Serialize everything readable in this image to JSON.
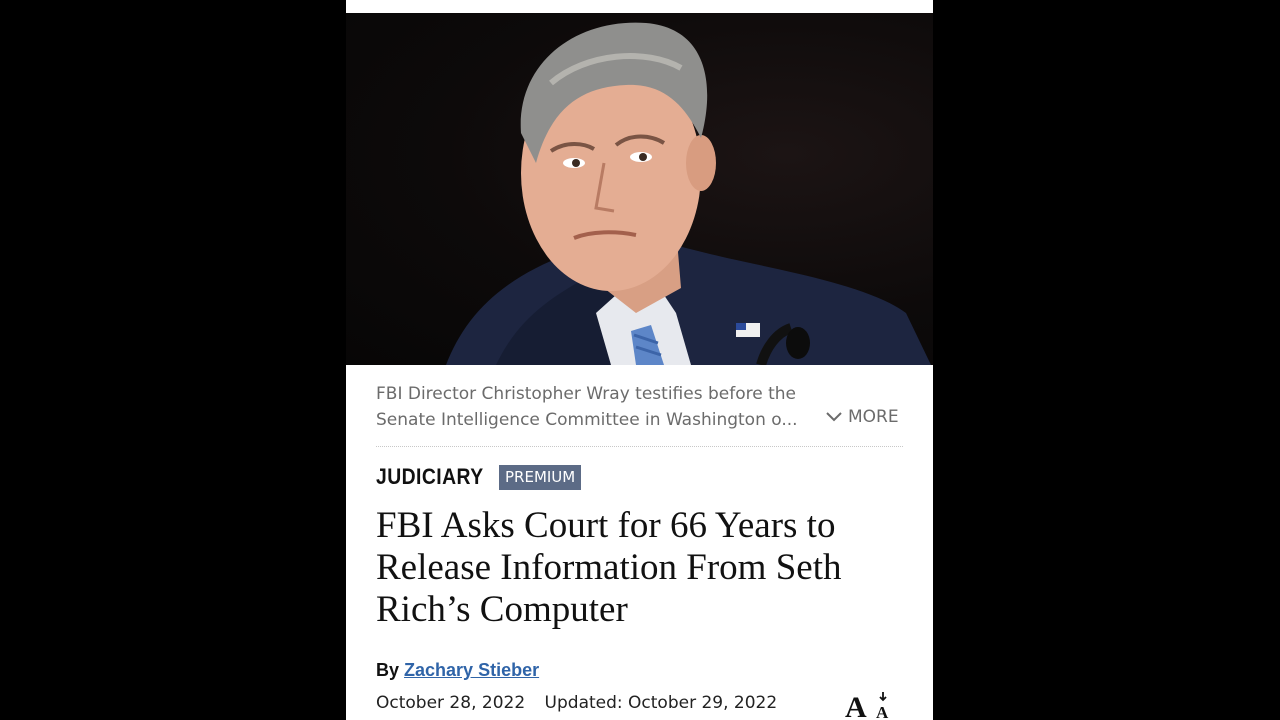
{
  "article": {
    "image_alt": "FBI Director Christopher Wray",
    "caption_lines": [
      "FBI Director Christopher Wray testifies before the",
      "Senate Intelligence Committee in Washington o..."
    ],
    "more_label": "MORE",
    "section": "JUDICIARY",
    "badge": "PREMIUM",
    "headline": "FBI Asks Court for 66 Years to Release Information From Seth Rich’s Computer",
    "byline_prefix": "By",
    "author": "Zachary Stieber",
    "published": "October 28, 2022",
    "updated": "Updated: October 29, 2022",
    "font_size_icon": "text-size-icon"
  },
  "colors": {
    "badge_bg": "#5c6b86",
    "author_link": "#2f64a8",
    "caption_text": "#6b6b6b"
  }
}
